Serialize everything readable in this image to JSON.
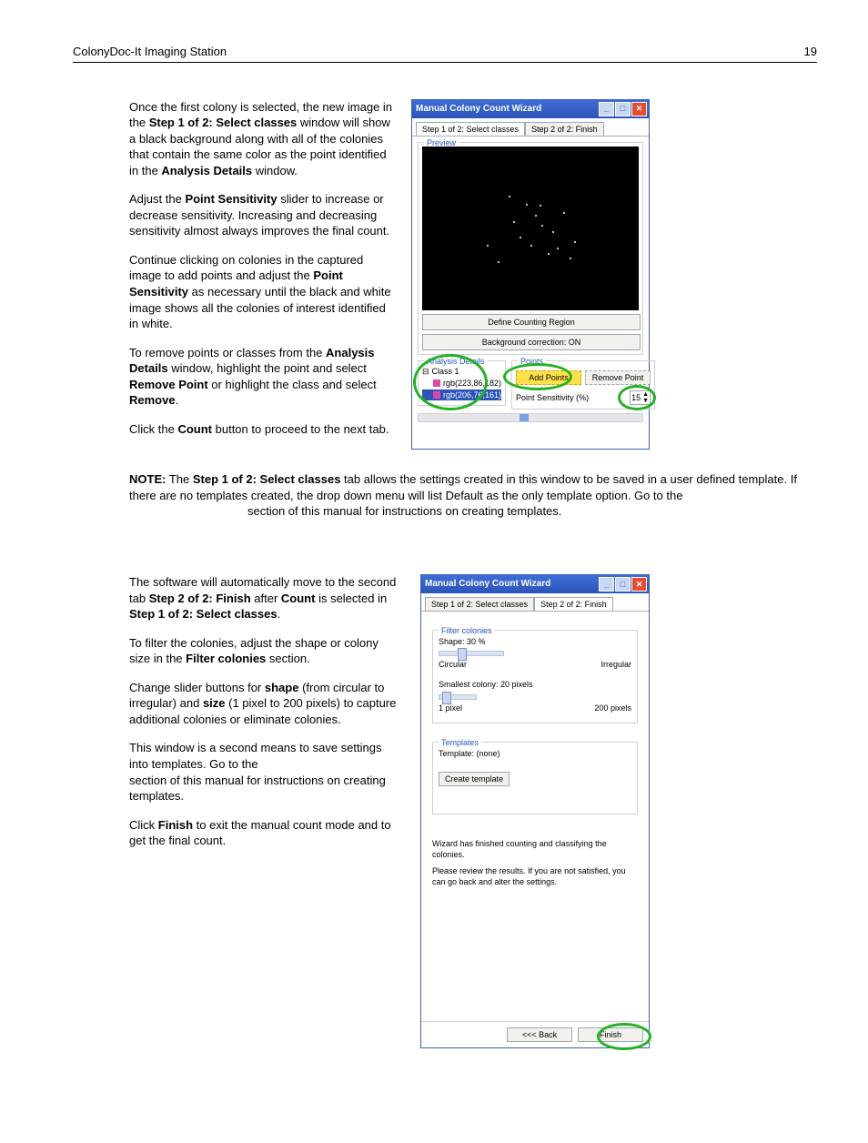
{
  "header": {
    "title": "ColonyDoc-It Imaging Station",
    "page": "19"
  },
  "section1": {
    "p1_a": "Once the first colony is selected, the new image in the ",
    "p1_b": "Step 1 of 2: Select classes",
    "p1_c": " window will show a black background along with all of the colonies that contain the same color as the point identified in the ",
    "p1_d": "Analysis Details",
    "p1_e": " window.",
    "p2_a": "Adjust the ",
    "p2_b": "Point Sensitivity",
    "p2_c": " slider to increase or decrease sensitivity. Increasing and decreasing sensitivity almost always improves the final count.",
    "p3_a": "Continue clicking on colonies in the captured image to add points and adjust the ",
    "p3_b": "Point Sensitivity",
    "p3_c": " as necessary until the black and white image shows all the colonies of interest identified in white.",
    "p4_a": "To remove points or classes from the ",
    "p4_b": "Analysis Details",
    "p4_c": " window, highlight the point and select ",
    "p4_d": "Remove Point",
    "p4_e": " or highlight the class and select ",
    "p4_f": "Remove",
    "p4_g": ".",
    "p5_a": "Click the ",
    "p5_b": "Count",
    "p5_c": " button to proceed to the next tab."
  },
  "note": {
    "a": "NOTE:",
    "b": " The ",
    "c": "Step 1 of 2: Select classes",
    "d": " tab allows the settings created in this window to be saved in a user defined template.   If there are no templates created, the drop down menu will list Default as the only template option.  Go to the ",
    "e": " section of this manual for instructions on creating templates."
  },
  "section2": {
    "p1_a": "The software will automatically move to the second tab ",
    "p1_b": "Step 2 of 2: Finish",
    "p1_c": " after ",
    "p1_d": "Count",
    "p1_e": " is selected in ",
    "p1_f": "Step 1 of 2: Select classes",
    "p1_g": ".",
    "p2_a": "To filter the colonies, adjust the shape or colony size in the ",
    "p2_b": "Filter colonies",
    "p2_c": " section.",
    "p3_a": "Change slider buttons for ",
    "p3_b": "shape",
    "p3_c": " (from circular to irregular) and ",
    "p3_d": "size",
    "p3_e": " (1 pixel to 200 pixels) to capture additional colonies or eliminate colonies.",
    "p4_a": "This window is a second means to save settings into templates.  Go to the ",
    "p4_b": " section of this manual for instructions on creating templates.",
    "p5_a": "Click ",
    "p5_b": "Finish",
    "p5_c": " to exit the manual count mode and to get the final count."
  },
  "wiz": {
    "title": "Manual Colony Count Wizard",
    "tab1": "Step 1 of 2: Select classes",
    "tab2": "Step 2 of 2: Finish",
    "preview": "Preview",
    "define_btn": "Define Counting Region",
    "bg_btn": "Background correction:  ON",
    "analysis": "Analysis Details",
    "class1": "Class 1",
    "rgb1": "rgb(223,86,182)",
    "rgb2": "rgb(206,76,161)",
    "points": "Points",
    "add": "Add Points",
    "remove": "Remove Point",
    "sens_label": "Point Sensitivity (%)",
    "sens_val": "15",
    "filter": "Filter colonies",
    "shape_lbl": "Shape: 30 %",
    "circ": "Circular",
    "irreg": "Irregular",
    "smallest": "Smallest colony: 20 pixels",
    "px1": "1 pixel",
    "px200": "200 pixels",
    "templates": "Templates",
    "tmpl_none": "Template: (none)",
    "create_tmpl": "Create template",
    "msg1": "Wizard has finished counting and classifying the colonies.",
    "msg2": "Please review the results. If you are not satisfied, you can go back and alter the settings.",
    "back": "<<< Back",
    "finish": "Finish"
  }
}
